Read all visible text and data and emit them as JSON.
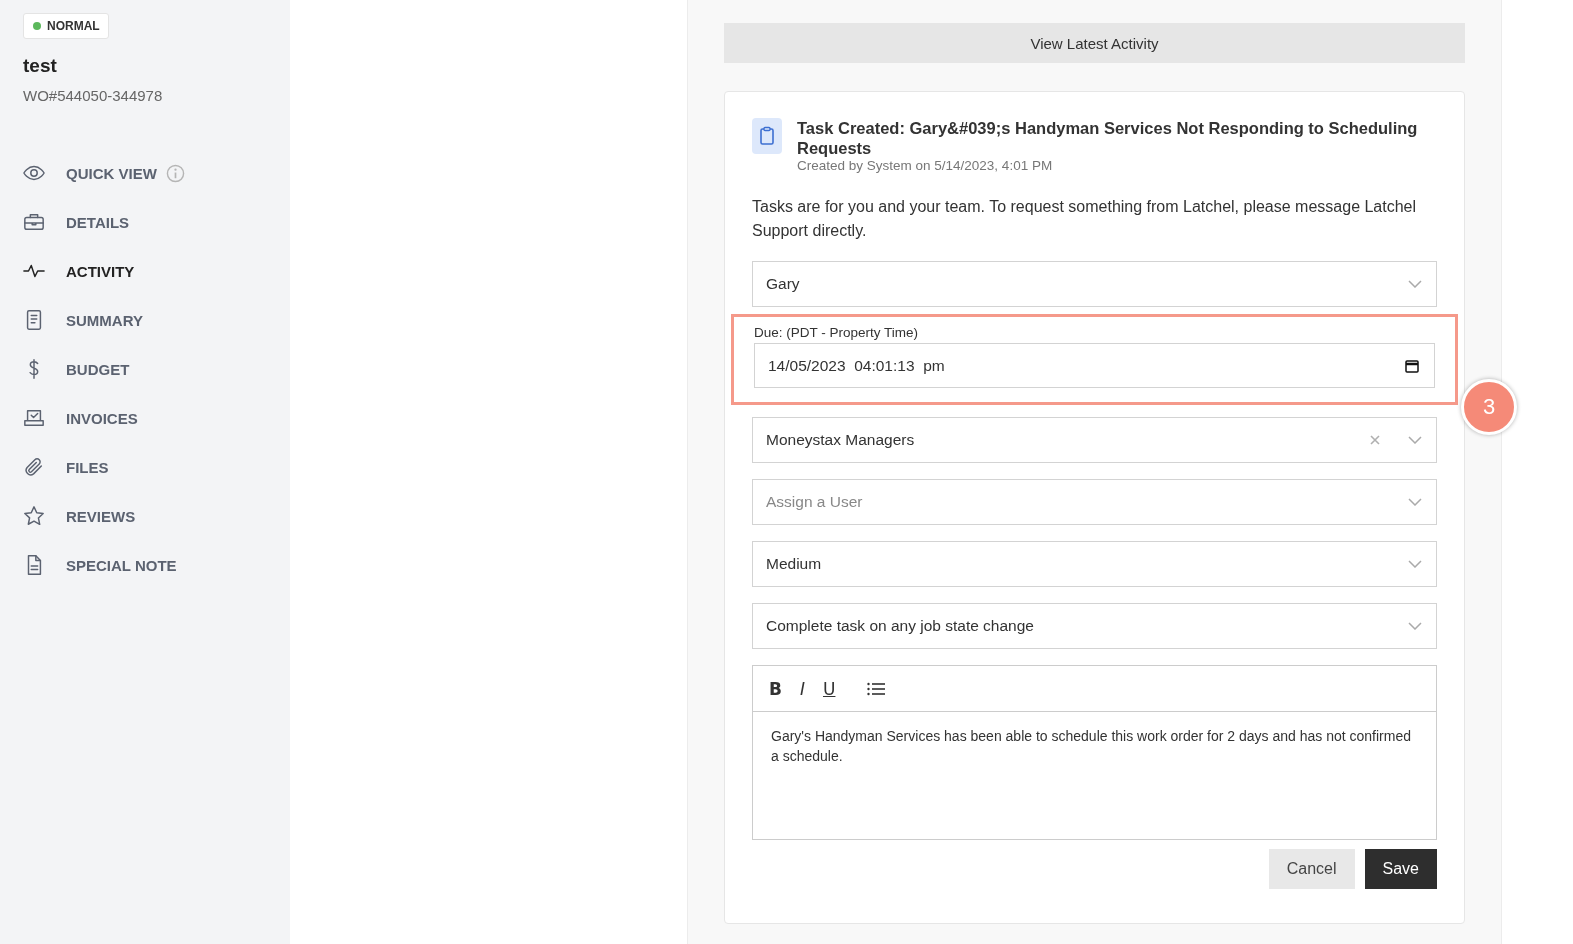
{
  "status_badge": {
    "label": "NORMAL",
    "color": "#5cb85c"
  },
  "title": "test",
  "work_order": "WO#544050-344978",
  "nav": [
    {
      "label": "QUICK VIEW",
      "kind": "eye",
      "info": true,
      "selected": false
    },
    {
      "label": "DETAILS",
      "kind": "briefcase",
      "info": false,
      "selected": false
    },
    {
      "label": "ACTIVITY",
      "kind": "pulse",
      "info": false,
      "selected": true
    },
    {
      "label": "SUMMARY",
      "kind": "summary",
      "info": false,
      "selected": false
    },
    {
      "label": "BUDGET",
      "kind": "dollar",
      "info": false,
      "selected": false
    },
    {
      "label": "INVOICES",
      "kind": "invoices",
      "info": false,
      "selected": false
    },
    {
      "label": "FILES",
      "kind": "paperclip",
      "info": false,
      "selected": false
    },
    {
      "label": "REVIEWS",
      "kind": "star",
      "info": false,
      "selected": false
    },
    {
      "label": "SPECIAL NOTE",
      "kind": "file",
      "info": false,
      "selected": false
    }
  ],
  "view_latest_button": "View Latest Activity",
  "task": {
    "title": "Task Created: Gary&#039;s Handyman Services Not Responding to Scheduling Requests",
    "meta": "Created by System on 5/14/2023, 4:01 PM",
    "notice": "Tasks are for you and your team. To request something from Latchel, please message Latchel Support directly.",
    "fields": [
      {
        "kind": "select",
        "value": "Gary",
        "clearable": false
      },
      {
        "kind": "datetime",
        "label": "Due: (PDT - Property Time)",
        "value": "14/05/2023  04:01:13  pm",
        "highlighted": true,
        "step": "3"
      },
      {
        "kind": "select",
        "value": "Moneystax Managers",
        "clearable": true
      },
      {
        "kind": "select",
        "placeholder": "Assign a User",
        "clearable": false
      },
      {
        "kind": "select",
        "value": "Medium",
        "clearable": false
      },
      {
        "kind": "select",
        "value": "Complete task on any job state change",
        "clearable": false
      }
    ],
    "editor": {
      "toolbar": [
        {
          "kind": "bold",
          "label": "B"
        },
        {
          "kind": "italic",
          "label": "I"
        },
        {
          "kind": "underline",
          "label": "U"
        },
        {
          "kind": "list"
        }
      ],
      "text": "Gary's Handyman Services has been able to schedule this work order for 2 days and has not confirmed a schedule."
    },
    "buttons": {
      "cancel": "Cancel",
      "save": "Save"
    }
  }
}
